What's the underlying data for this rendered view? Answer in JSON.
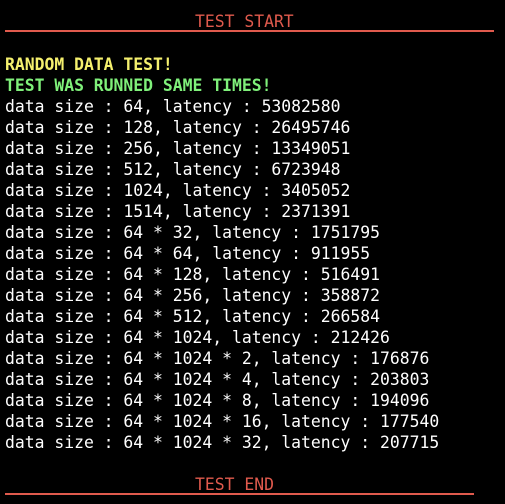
{
  "colors": {
    "background": "#000000",
    "default_text": "#ffffff",
    "banner": "#e05a4d",
    "heading_yellow": "#f5f06e",
    "heading_green": "#7ff07a"
  },
  "banner_start": "TEST START",
  "banner_end": "TEST END",
  "headings": {
    "random_test": "RANDOM DATA TEST!",
    "runned_same": "TEST WAS RUNNED SAME TIMES!"
  },
  "results": [
    "data size : 64, latency : 53082580",
    "data size : 128, latency : 26495746",
    "data size : 256, latency : 13349051",
    "data size : 512, latency : 6723948",
    "data size : 1024, latency : 3405052",
    "data size : 1514, latency : 2371391",
    "data size : 64 * 32, latency : 1751795",
    "data size : 64 * 64, latency : 911955",
    "data size : 64 * 128, latency : 516491",
    "data size : 64 * 256, latency : 358872",
    "data size : 64 * 512, latency : 266584",
    "data size : 64 * 1024, latency : 212426",
    "data size : 64 * 1024 * 2, latency : 176876",
    "data size : 64 * 1024 * 4, latency : 203803",
    "data size : 64 * 1024 * 8, latency : 194096",
    "data size : 64 * 1024 * 16, latency : 177540",
    "data size : 64 * 1024 * 32, latency : 207715"
  ]
}
